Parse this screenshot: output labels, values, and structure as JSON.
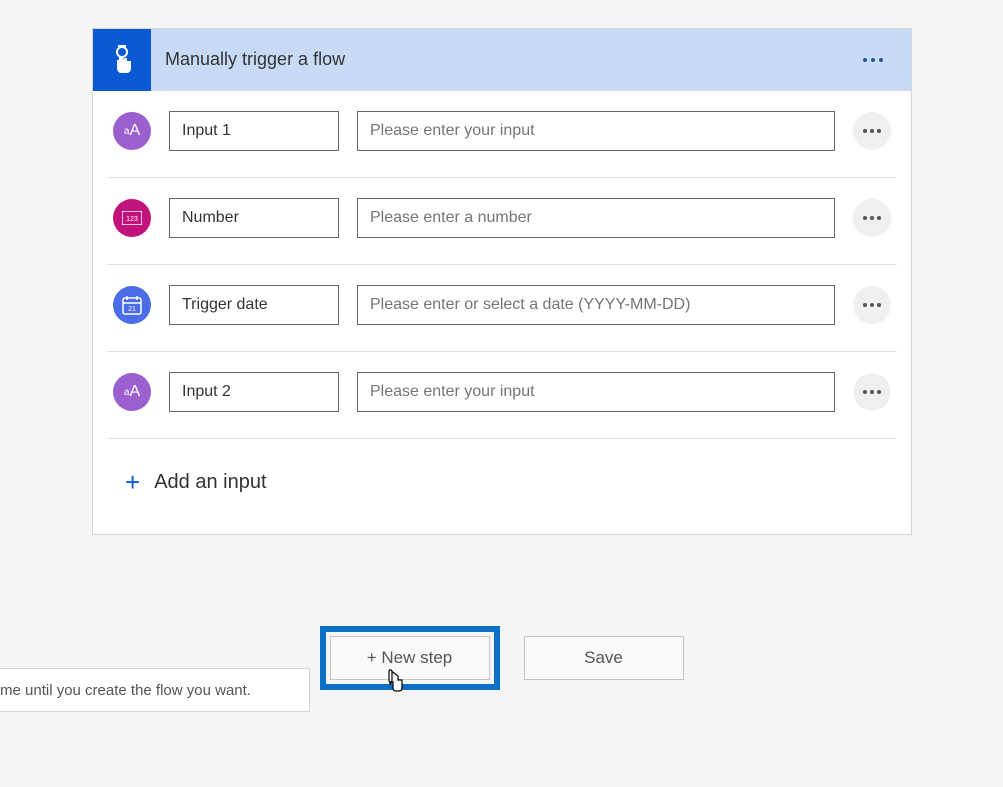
{
  "trigger": {
    "title": "Manually trigger a flow",
    "inputs": [
      {
        "icon": "text",
        "iconLabel": "aA",
        "name": "Input 1",
        "placeholder": "Please enter your input"
      },
      {
        "icon": "number",
        "iconLabel": "123",
        "name": "Number",
        "placeholder": "Please enter a number"
      },
      {
        "icon": "date",
        "iconLabel": "",
        "name": "Trigger date",
        "placeholder": "Please enter or select a date (YYYY-MM-DD)"
      },
      {
        "icon": "text",
        "iconLabel": "aA",
        "name": "Input 2",
        "placeholder": "Please enter your input"
      }
    ],
    "addInputLabel": "Add an input"
  },
  "buttons": {
    "newStep": "+ New step",
    "save": "Save"
  },
  "hint": "me until you create the flow you want."
}
